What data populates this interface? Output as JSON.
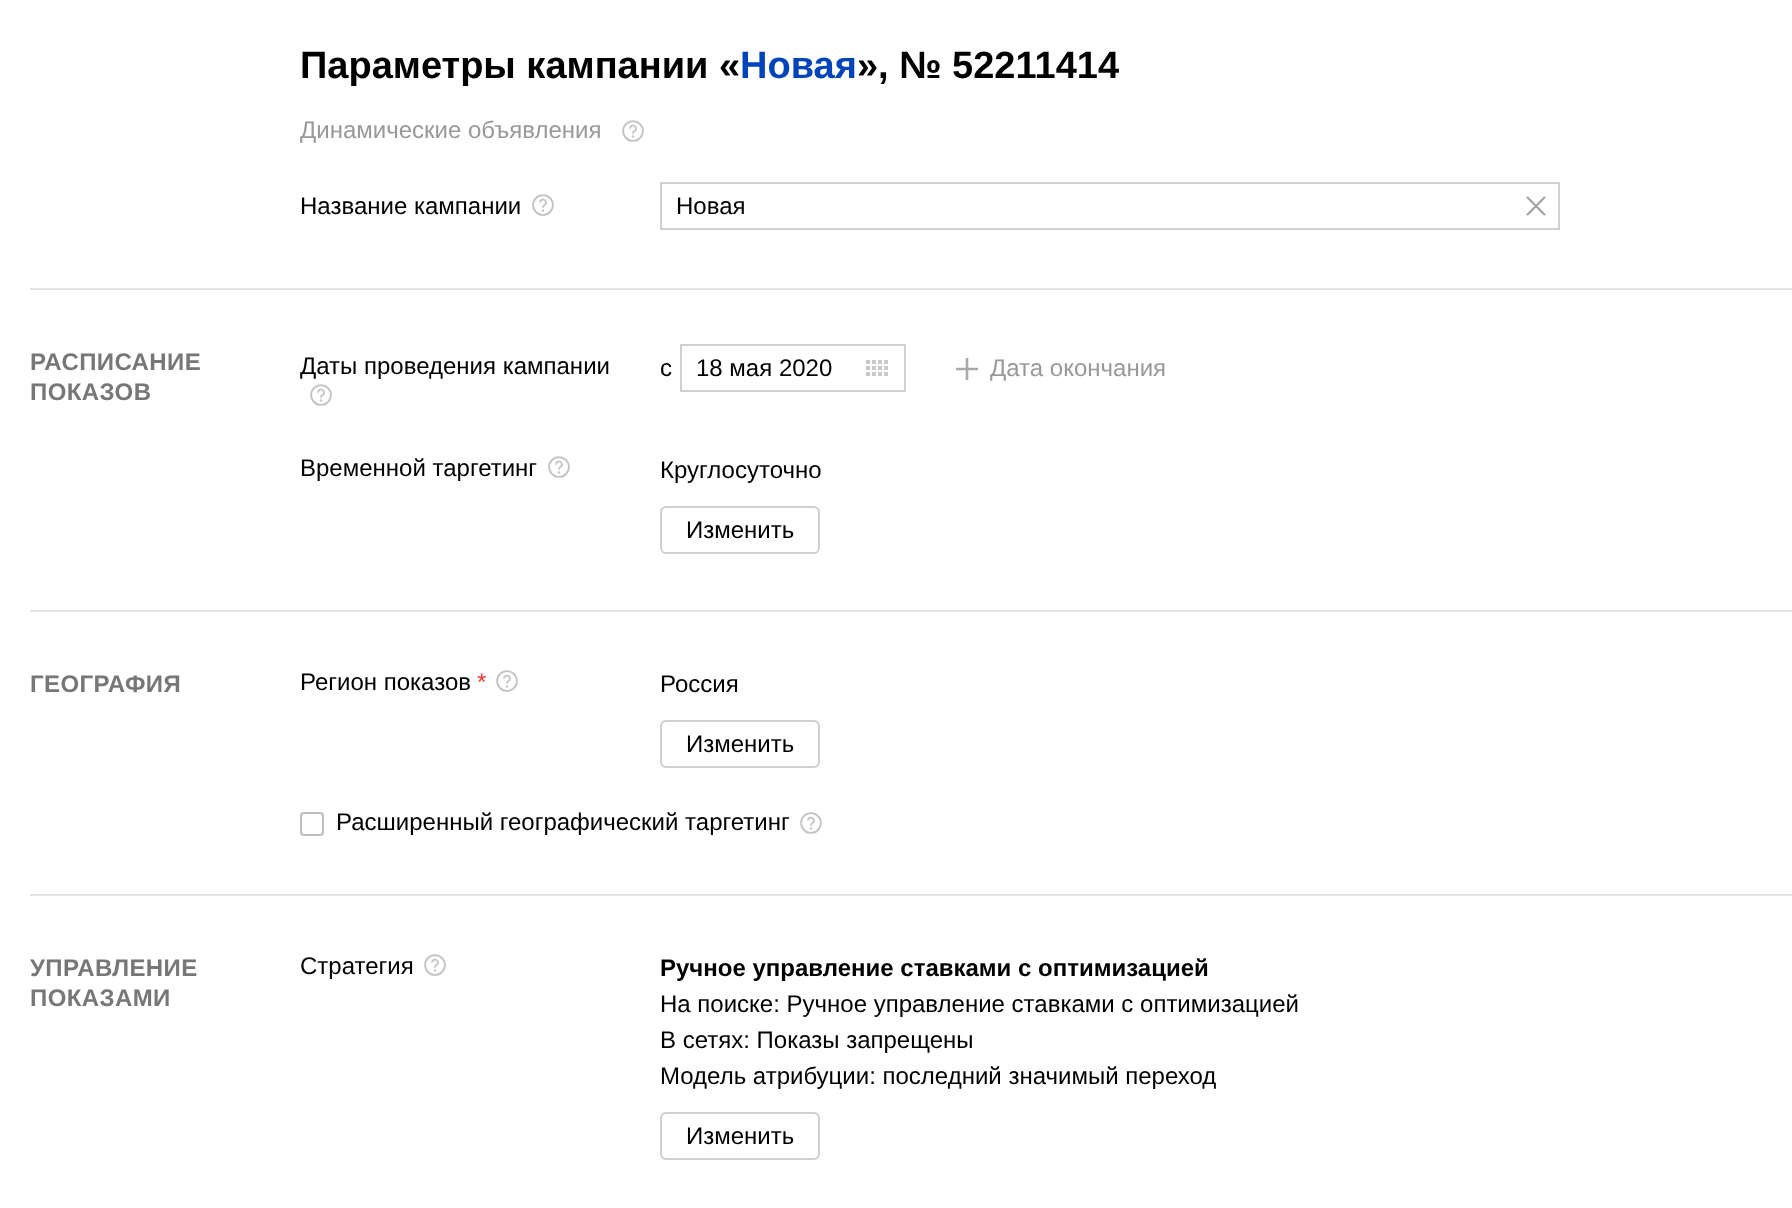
{
  "header": {
    "title_before": "Параметры кампании «",
    "campaign_link": "Новая",
    "title_after": "», № 52211414",
    "campaign_type": "Динамические объявления"
  },
  "name_field": {
    "label": "Название кампании",
    "value": "Новая"
  },
  "sections": [
    {
      "title": "РАСПИСАНИЕ ПОКАЗОВ",
      "rows": [
        {
          "kind": "dates",
          "label": "Даты проведения кампании",
          "prefix": "с",
          "start_date": "18 мая 2020",
          "add_end": "Дата окончания"
        },
        {
          "kind": "value",
          "label": "Временной таргетинг",
          "lines": [
            "Круглосуточно"
          ],
          "button": "Изменить"
        }
      ]
    },
    {
      "title": "ГЕОГРАФИЯ",
      "rows": [
        {
          "kind": "value",
          "label": "Регион показов",
          "required_mark": "*",
          "lines": [
            "Россия"
          ],
          "button": "Изменить"
        },
        {
          "kind": "checkbox",
          "label": "Расширенный географический таргетинг",
          "checked": false
        }
      ]
    },
    {
      "title": "УПРАВЛЕНИЕ ПОКАЗАМИ",
      "rows": [
        {
          "kind": "value",
          "label": "Стратегия",
          "heading": "Ручное управление ставками с оптимизацией",
          "lines": [
            "На поиске: Ручное управление ставками с оптимизацией",
            "В сетях: Показы запрещены",
            "Модель атрибуции: последний значимый переход"
          ],
          "button": "Изменить"
        }
      ]
    }
  ]
}
